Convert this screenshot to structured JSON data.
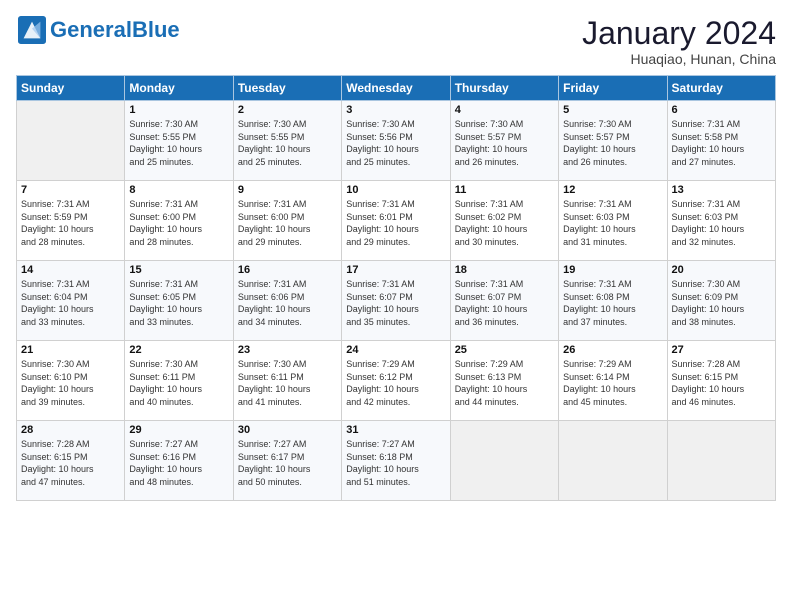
{
  "logo": {
    "text_general": "General",
    "text_blue": "Blue"
  },
  "header": {
    "title": "January 2024",
    "subtitle": "Huaqiao, Hunan, China"
  },
  "weekdays": [
    "Sunday",
    "Monday",
    "Tuesday",
    "Wednesday",
    "Thursday",
    "Friday",
    "Saturday"
  ],
  "weeks": [
    [
      {
        "day": "",
        "info": ""
      },
      {
        "day": "1",
        "info": "Sunrise: 7:30 AM\nSunset: 5:55 PM\nDaylight: 10 hours\nand 25 minutes."
      },
      {
        "day": "2",
        "info": "Sunrise: 7:30 AM\nSunset: 5:55 PM\nDaylight: 10 hours\nand 25 minutes."
      },
      {
        "day": "3",
        "info": "Sunrise: 7:30 AM\nSunset: 5:56 PM\nDaylight: 10 hours\nand 25 minutes."
      },
      {
        "day": "4",
        "info": "Sunrise: 7:30 AM\nSunset: 5:57 PM\nDaylight: 10 hours\nand 26 minutes."
      },
      {
        "day": "5",
        "info": "Sunrise: 7:30 AM\nSunset: 5:57 PM\nDaylight: 10 hours\nand 26 minutes."
      },
      {
        "day": "6",
        "info": "Sunrise: 7:31 AM\nSunset: 5:58 PM\nDaylight: 10 hours\nand 27 minutes."
      }
    ],
    [
      {
        "day": "7",
        "info": "Sunrise: 7:31 AM\nSunset: 5:59 PM\nDaylight: 10 hours\nand 28 minutes."
      },
      {
        "day": "8",
        "info": "Sunrise: 7:31 AM\nSunset: 6:00 PM\nDaylight: 10 hours\nand 28 minutes."
      },
      {
        "day": "9",
        "info": "Sunrise: 7:31 AM\nSunset: 6:00 PM\nDaylight: 10 hours\nand 29 minutes."
      },
      {
        "day": "10",
        "info": "Sunrise: 7:31 AM\nSunset: 6:01 PM\nDaylight: 10 hours\nand 29 minutes."
      },
      {
        "day": "11",
        "info": "Sunrise: 7:31 AM\nSunset: 6:02 PM\nDaylight: 10 hours\nand 30 minutes."
      },
      {
        "day": "12",
        "info": "Sunrise: 7:31 AM\nSunset: 6:03 PM\nDaylight: 10 hours\nand 31 minutes."
      },
      {
        "day": "13",
        "info": "Sunrise: 7:31 AM\nSunset: 6:03 PM\nDaylight: 10 hours\nand 32 minutes."
      }
    ],
    [
      {
        "day": "14",
        "info": "Sunrise: 7:31 AM\nSunset: 6:04 PM\nDaylight: 10 hours\nand 33 minutes."
      },
      {
        "day": "15",
        "info": "Sunrise: 7:31 AM\nSunset: 6:05 PM\nDaylight: 10 hours\nand 33 minutes."
      },
      {
        "day": "16",
        "info": "Sunrise: 7:31 AM\nSunset: 6:06 PM\nDaylight: 10 hours\nand 34 minutes."
      },
      {
        "day": "17",
        "info": "Sunrise: 7:31 AM\nSunset: 6:07 PM\nDaylight: 10 hours\nand 35 minutes."
      },
      {
        "day": "18",
        "info": "Sunrise: 7:31 AM\nSunset: 6:07 PM\nDaylight: 10 hours\nand 36 minutes."
      },
      {
        "day": "19",
        "info": "Sunrise: 7:31 AM\nSunset: 6:08 PM\nDaylight: 10 hours\nand 37 minutes."
      },
      {
        "day": "20",
        "info": "Sunrise: 7:30 AM\nSunset: 6:09 PM\nDaylight: 10 hours\nand 38 minutes."
      }
    ],
    [
      {
        "day": "21",
        "info": "Sunrise: 7:30 AM\nSunset: 6:10 PM\nDaylight: 10 hours\nand 39 minutes."
      },
      {
        "day": "22",
        "info": "Sunrise: 7:30 AM\nSunset: 6:11 PM\nDaylight: 10 hours\nand 40 minutes."
      },
      {
        "day": "23",
        "info": "Sunrise: 7:30 AM\nSunset: 6:11 PM\nDaylight: 10 hours\nand 41 minutes."
      },
      {
        "day": "24",
        "info": "Sunrise: 7:29 AM\nSunset: 6:12 PM\nDaylight: 10 hours\nand 42 minutes."
      },
      {
        "day": "25",
        "info": "Sunrise: 7:29 AM\nSunset: 6:13 PM\nDaylight: 10 hours\nand 44 minutes."
      },
      {
        "day": "26",
        "info": "Sunrise: 7:29 AM\nSunset: 6:14 PM\nDaylight: 10 hours\nand 45 minutes."
      },
      {
        "day": "27",
        "info": "Sunrise: 7:28 AM\nSunset: 6:15 PM\nDaylight: 10 hours\nand 46 minutes."
      }
    ],
    [
      {
        "day": "28",
        "info": "Sunrise: 7:28 AM\nSunset: 6:15 PM\nDaylight: 10 hours\nand 47 minutes."
      },
      {
        "day": "29",
        "info": "Sunrise: 7:27 AM\nSunset: 6:16 PM\nDaylight: 10 hours\nand 48 minutes."
      },
      {
        "day": "30",
        "info": "Sunrise: 7:27 AM\nSunset: 6:17 PM\nDaylight: 10 hours\nand 50 minutes."
      },
      {
        "day": "31",
        "info": "Sunrise: 7:27 AM\nSunset: 6:18 PM\nDaylight: 10 hours\nand 51 minutes."
      },
      {
        "day": "",
        "info": ""
      },
      {
        "day": "",
        "info": ""
      },
      {
        "day": "",
        "info": ""
      }
    ]
  ]
}
